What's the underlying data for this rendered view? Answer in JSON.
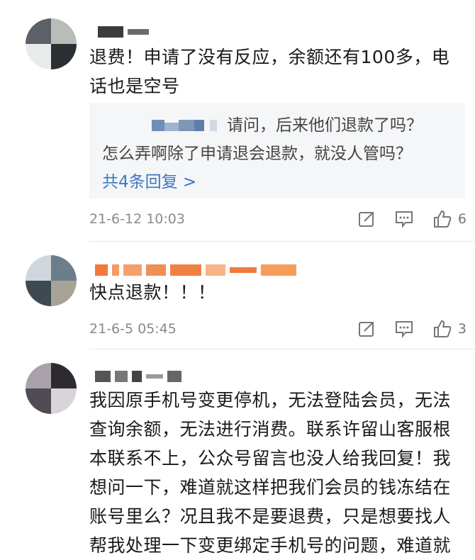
{
  "comments": [
    {
      "text": "退费！申请了没有反应，余额还有100多，电话也是空号",
      "reply_user_text": "请问，后来他们退款了吗？",
      "reply_text": "怎么弄啊除了申请退会退款，就没人管吗？",
      "reply_more": "共4条回复 >",
      "time": "21-6-12 10:03",
      "likes": "6"
    },
    {
      "text": "快点退款！！！",
      "time": "21-6-5 05:45",
      "likes": "3"
    },
    {
      "text": "我因原手机号变更停机，无法登陆会员，无法查询余额，无法进行消费。联系许留山客服根本联系不上，公众号留言也没人给我回复！我想问一下，难道就这样把我们会员的钱冻结在账号里么？况且我不是要退费，只是想要找人帮我处理一下变更绑定手机号的问题，难道就"
    }
  ],
  "icons": {
    "share": "share-icon",
    "comment": "comment-icon",
    "like": "thumbs-up-icon"
  },
  "colors": {
    "link": "#3a78c3",
    "meta": "#8a8a8a",
    "reply_bg": "#f5f6f8"
  }
}
